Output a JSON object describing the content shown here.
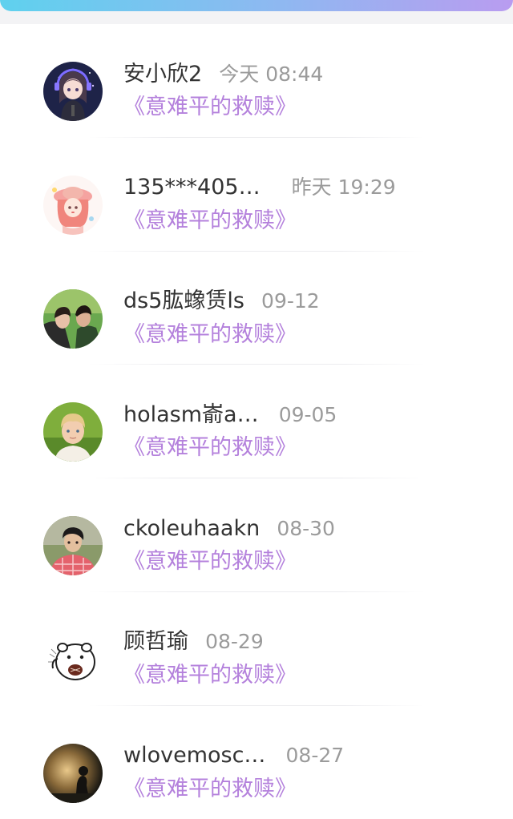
{
  "colors": {
    "accent_purple": "#b481dc",
    "name_text": "#333333",
    "time_text": "#9b9b9b",
    "header_gradient_start": "#5fd1ee",
    "header_gradient_end": "#b99cf0"
  },
  "readers": [
    {
      "name": "安小欣2",
      "time": "今天 08:44",
      "book": "《意难平的救赎》",
      "avatar": "anime-girl-headset-avatar"
    },
    {
      "name": "135***405…",
      "time": "昨天 19:29",
      "book": "《意难平的救赎》",
      "avatar": "cartoon-girl-pink-hat-avatar"
    },
    {
      "name": "ds5肱蟓赁ls",
      "time": "09-12",
      "book": "《意难平的救赎》",
      "avatar": "couple-photo-avatar"
    },
    {
      "name": "holasm嵛a…",
      "time": "09-05",
      "book": "《意难平的救赎》",
      "avatar": "blond-boy-photo-avatar"
    },
    {
      "name": "ckoleuhaakn",
      "time": "08-30",
      "book": "《意难平的救赎》",
      "avatar": "boy-plaid-shirt-avatar"
    },
    {
      "name": "顾哲瑜",
      "time": "08-29",
      "book": "《意难平的救赎》",
      "avatar": "hamster-cartoon-avatar"
    },
    {
      "name": "wlovemosc…",
      "time": "08-27",
      "book": "《意难平的救赎》",
      "avatar": "silhouette-sunset-avatar"
    }
  ]
}
